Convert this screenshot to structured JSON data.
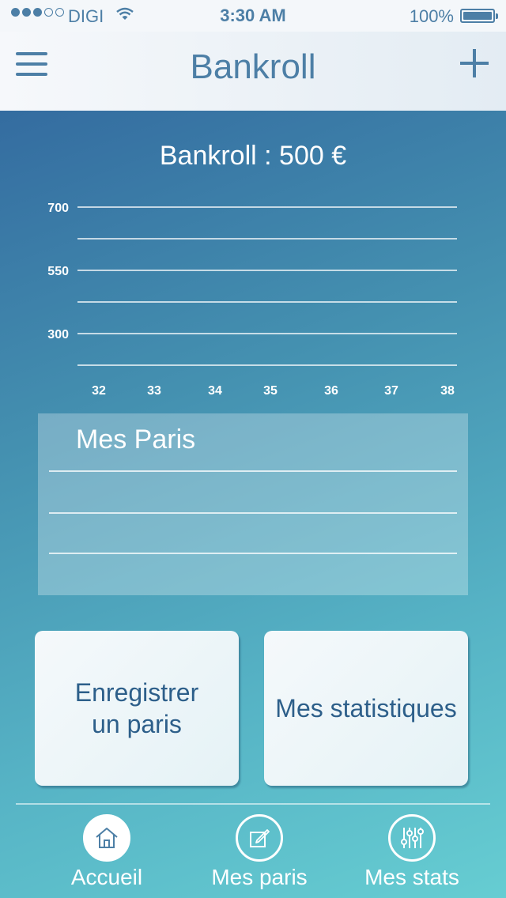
{
  "status_bar": {
    "carrier": "DIGI",
    "time": "3:30 AM",
    "battery_pct": "100%",
    "signal_bars_filled": 3,
    "signal_bars_total": 5
  },
  "navbar": {
    "title": "Bankroll",
    "menu_icon": "hamburger-icon",
    "add_icon": "plus-icon"
  },
  "bankroll_label": "Bankroll : 500 €",
  "chart_data": {
    "type": "line",
    "title": "",
    "xlabel": "",
    "ylabel": "",
    "y_tick_labels": [
      "700",
      "550",
      "300"
    ],
    "x_tick_labels": [
      "32",
      "33",
      "34",
      "35",
      "36",
      "37",
      "38"
    ],
    "series": [],
    "grid": true
  },
  "mes_paris": {
    "title": "Mes Paris"
  },
  "cards": {
    "enregistrer_line1": "Enregistrer",
    "enregistrer_line2": "un paris",
    "statistiques": "Mes statistiques"
  },
  "tabs": [
    {
      "label": "Accueil",
      "icon": "home-icon",
      "active": true
    },
    {
      "label": "Mes paris",
      "icon": "edit-icon",
      "active": false
    },
    {
      "label": "Mes stats",
      "icon": "sliders-icon",
      "active": false
    }
  ],
  "colors": {
    "accent": "#4d7fa6",
    "card_text": "#2d5f8a",
    "background_top": "#346ca0",
    "background_bottom": "#66cdd2"
  }
}
